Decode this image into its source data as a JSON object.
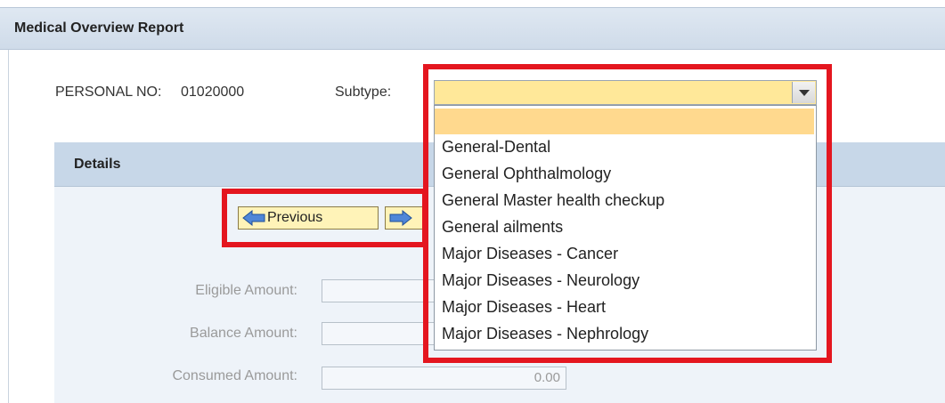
{
  "header": {
    "title": "Medical Overview Report"
  },
  "form": {
    "personal_no_label": "PERSONAL NO:",
    "personal_no_value": "01020000",
    "subtype_label": "Subtype:",
    "subtype_value": ""
  },
  "details": {
    "title": "Details",
    "previous_label": "Previous",
    "eligible_label": "Eligible Amount:",
    "balance_label": "Balance Amount:",
    "consumed_label": "Consumed Amount:",
    "consumed_value": "0.00"
  },
  "dropdown": {
    "options": [
      "",
      "General-Dental",
      "General Ophthalmology",
      "General Master health checkup",
      "General ailments",
      "Major Diseases - Cancer",
      "Major Diseases - Neurology",
      "Major Diseases - Heart",
      "Major Diseases - Nephrology"
    ]
  },
  "colors": {
    "highlight_border": "#e4161f",
    "selected_option": "#ffd98e",
    "select_background": "#ffe899",
    "button_background": "#fff3b8"
  },
  "icons": {
    "select_arrow": "chevron-down-icon",
    "previous": "arrow-left-icon",
    "next": "arrow-right-icon"
  }
}
